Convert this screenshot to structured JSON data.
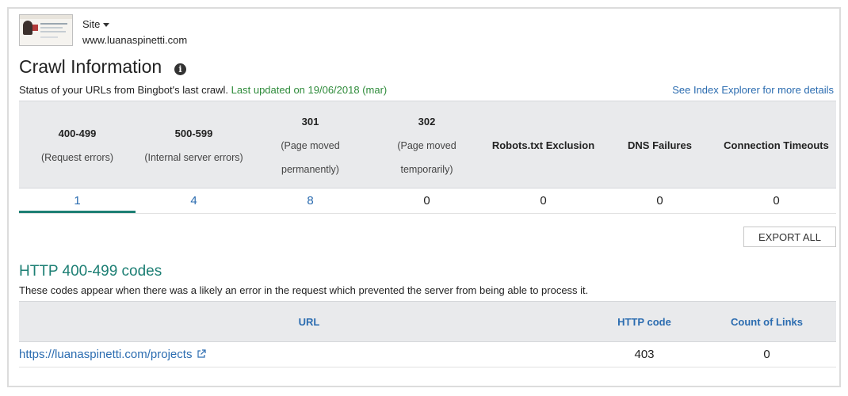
{
  "header": {
    "site_label": "Site",
    "site_url": "www.luanaspinetti.com"
  },
  "page": {
    "title": "Crawl Information",
    "status_text": "Status of your URLs from Bingbot's last crawl.",
    "last_updated": "Last updated on 19/06/2018 (mar)",
    "see_index_link": "See Index Explorer for more details"
  },
  "summary": {
    "columns": [
      {
        "code": "400-499",
        "desc": "(Request errors)",
        "value": "1"
      },
      {
        "code": "500-599",
        "desc": "(Internal server errors)",
        "value": "4"
      },
      {
        "code": "301",
        "desc_line1": "(Page moved",
        "desc_line2": "permanently)",
        "value": "8"
      },
      {
        "code": "302",
        "desc_line1": "(Page moved",
        "desc_line2": "temporarily)",
        "value": "0"
      },
      {
        "code": "Robots.txt Exclusion",
        "value": "0"
      },
      {
        "code": "DNS Failures",
        "value": "0"
      },
      {
        "code": "Connection Timeouts",
        "value": "0"
      }
    ],
    "active_tab_color": "#1d7f74",
    "link_color": "#2b6cb0"
  },
  "actions": {
    "export_all": "EXPORT ALL"
  },
  "section": {
    "title": "HTTP 400-499 codes",
    "description": "These codes appear when there was a likely an error in the request which prevented the server from being able to process it."
  },
  "table": {
    "headers": {
      "url": "URL",
      "http_code": "HTTP code",
      "count_links": "Count of Links"
    },
    "rows": [
      {
        "url": "https://luanaspinetti.com/projects",
        "http_code": "403",
        "count_links": "0"
      }
    ]
  },
  "icons": {
    "info": "info-icon",
    "external_link": "external-link-icon",
    "dropdown": "chevron-down-icon"
  }
}
